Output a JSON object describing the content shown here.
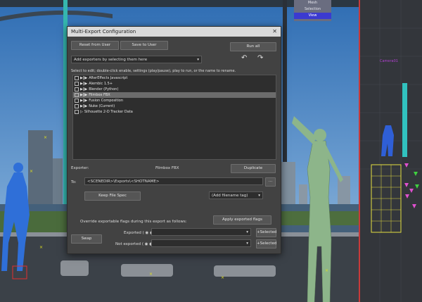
{
  "viewport_menu": {
    "items": [
      "Mesh",
      "Selection",
      "View"
    ]
  },
  "dialog": {
    "title": "Multi-Export Configuration",
    "close_glyph": "✕",
    "reset_label": "Reset from User",
    "save_label": "Save to User",
    "run_all_label": "Run all",
    "add_exporters_placeholder": "Add exporters by selecting them here",
    "instructions": "Select to edit; double-click enable, settings (play/pause), play to run, or the name to rename.",
    "exporters": [
      {
        "name": "AfterEffects Javascript",
        "enabled": true,
        "selected": false
      },
      {
        "name": "Alembic 1.5+",
        "enabled": true,
        "selected": false
      },
      {
        "name": "Blender (Python)",
        "enabled": true,
        "selected": false
      },
      {
        "name": "Filmbox FBX",
        "enabled": true,
        "selected": true
      },
      {
        "name": "Fusion Composition",
        "enabled": true,
        "selected": false
      },
      {
        "name": "Nuke (Current)",
        "enabled": true,
        "selected": false
      },
      {
        "name": "Silhouette 2-D Tracker Data",
        "enabled": false,
        "selected": false
      }
    ],
    "exporter_label": "Exporter:",
    "exporter_name": "Filmbox FBX",
    "duplicate_label": "Duplicate",
    "to_label": "To:",
    "to_path": "<SCENEDIR>\\Exports\\<SHOTNAME>",
    "browse_label": "...",
    "keep_file_spec_label": "Keep File Spec",
    "add_filename_tag_label": "(Add filename tag)",
    "override_text": "Override exportable flags during this export as follows:",
    "apply_flags_label": "Apply exported flags",
    "swap_label": "Swap",
    "exported_label": "Exported (",
    "not_exported_label": "Not exported (",
    "selected_label": "+Selected",
    "selected_label2": "+Selected"
  }
}
